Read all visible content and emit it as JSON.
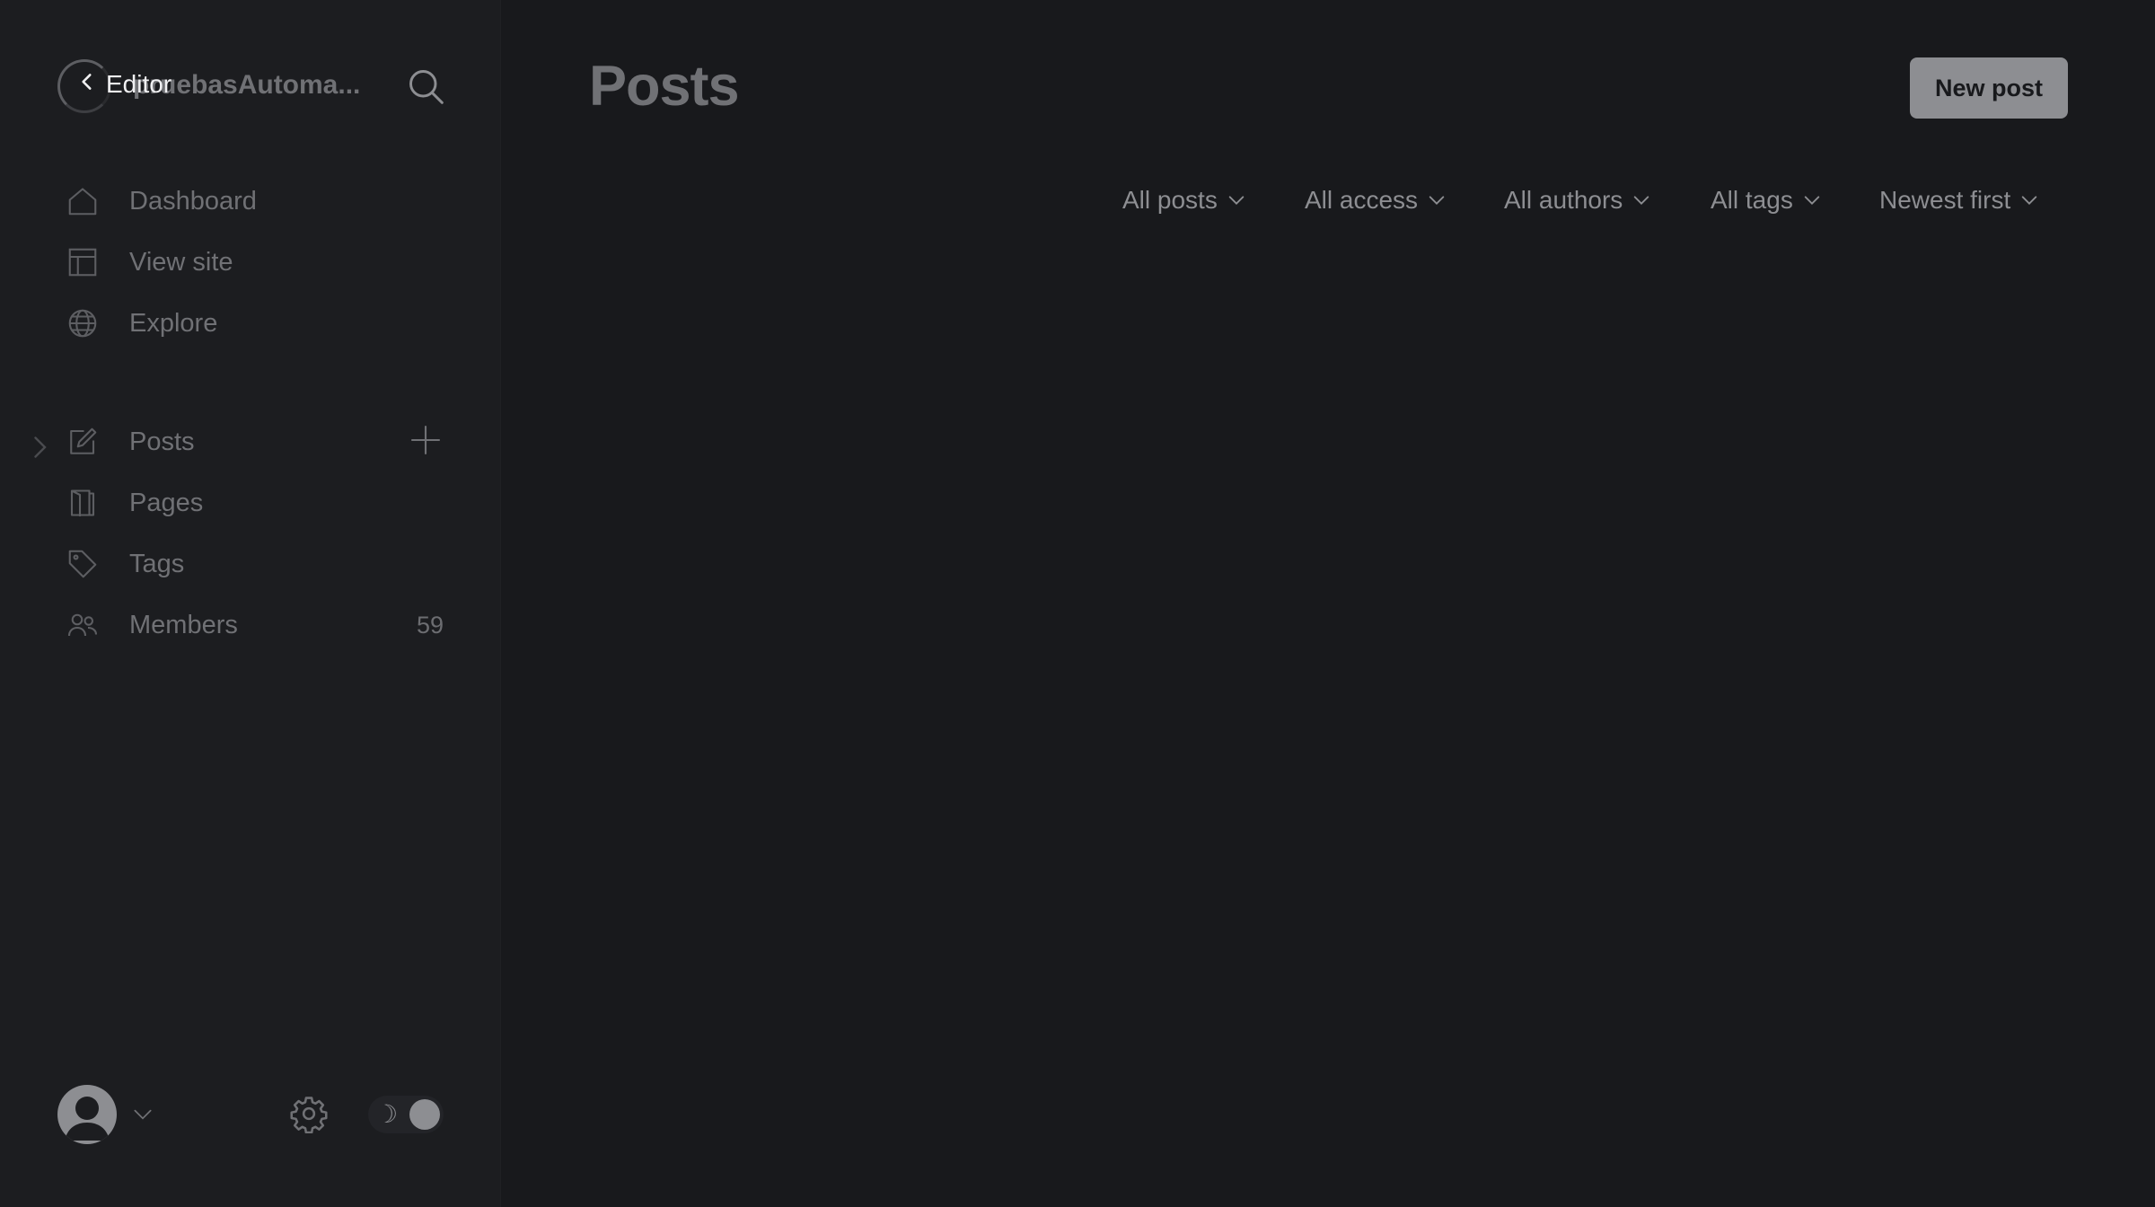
{
  "sidebar": {
    "site_title": "pruebasAutoma...",
    "back_label": "Editor",
    "nav_top": [
      {
        "label": "Dashboard",
        "icon": "home-icon"
      },
      {
        "label": "View site",
        "icon": "layout-icon"
      },
      {
        "label": "Explore",
        "icon": "globe-icon"
      }
    ],
    "nav_main": [
      {
        "label": "Posts",
        "icon": "pencil-icon"
      },
      {
        "label": "Pages",
        "icon": "pages-icon"
      },
      {
        "label": "Tags",
        "icon": "tag-icon"
      },
      {
        "label": "Members",
        "icon": "members-icon",
        "count": "59"
      }
    ]
  },
  "main": {
    "title": "Posts",
    "new_post_label": "New post",
    "filters": [
      {
        "label": "All posts"
      },
      {
        "label": "All access"
      },
      {
        "label": "All authors"
      },
      {
        "label": "All tags"
      },
      {
        "label": "Newest first"
      }
    ]
  },
  "theme": {
    "background": "#18191c",
    "sidebar_background": "#1c1d20",
    "muted_text": "#8d8e92"
  }
}
